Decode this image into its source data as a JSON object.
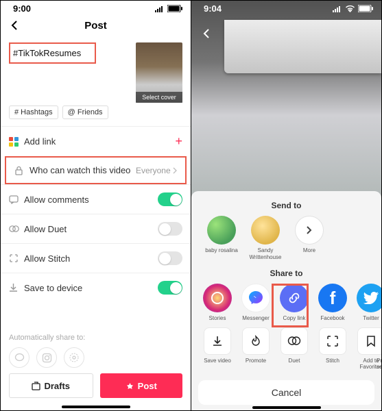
{
  "left": {
    "time": "9:00",
    "title": "Post",
    "caption": "#TikTokResumes",
    "select_cover": "Select cover",
    "chips": {
      "hashtags": "# Hashtags",
      "friends": "@ Friends"
    },
    "rows": {
      "addlink": "Add link",
      "privacy_label": "Who can watch this video",
      "privacy_value": "Everyone",
      "comments": "Allow comments",
      "duet": "Allow Duet",
      "stitch": "Allow Stitch",
      "save": "Save to device"
    },
    "autoshare": "Automatically share to:",
    "drafts": "Drafts",
    "post": "Post"
  },
  "right": {
    "time": "9:04",
    "sendto": "Send to",
    "contacts": {
      "c1": "baby rosalina",
      "c2": "Sandy Writtenhouse",
      "more": "More"
    },
    "shareto": "Share to",
    "share": {
      "stories": "Stories",
      "messenger": "Messenger",
      "copylink": "Copy link",
      "facebook": "Facebook",
      "twitter": "Twitter"
    },
    "actions": {
      "savevideo": "Save video",
      "promote": "Promote",
      "duet": "Duet",
      "stitch": "Stitch",
      "fav": "Add to Favorites",
      "privacy": "Privacy settings"
    },
    "cancel": "Cancel"
  }
}
